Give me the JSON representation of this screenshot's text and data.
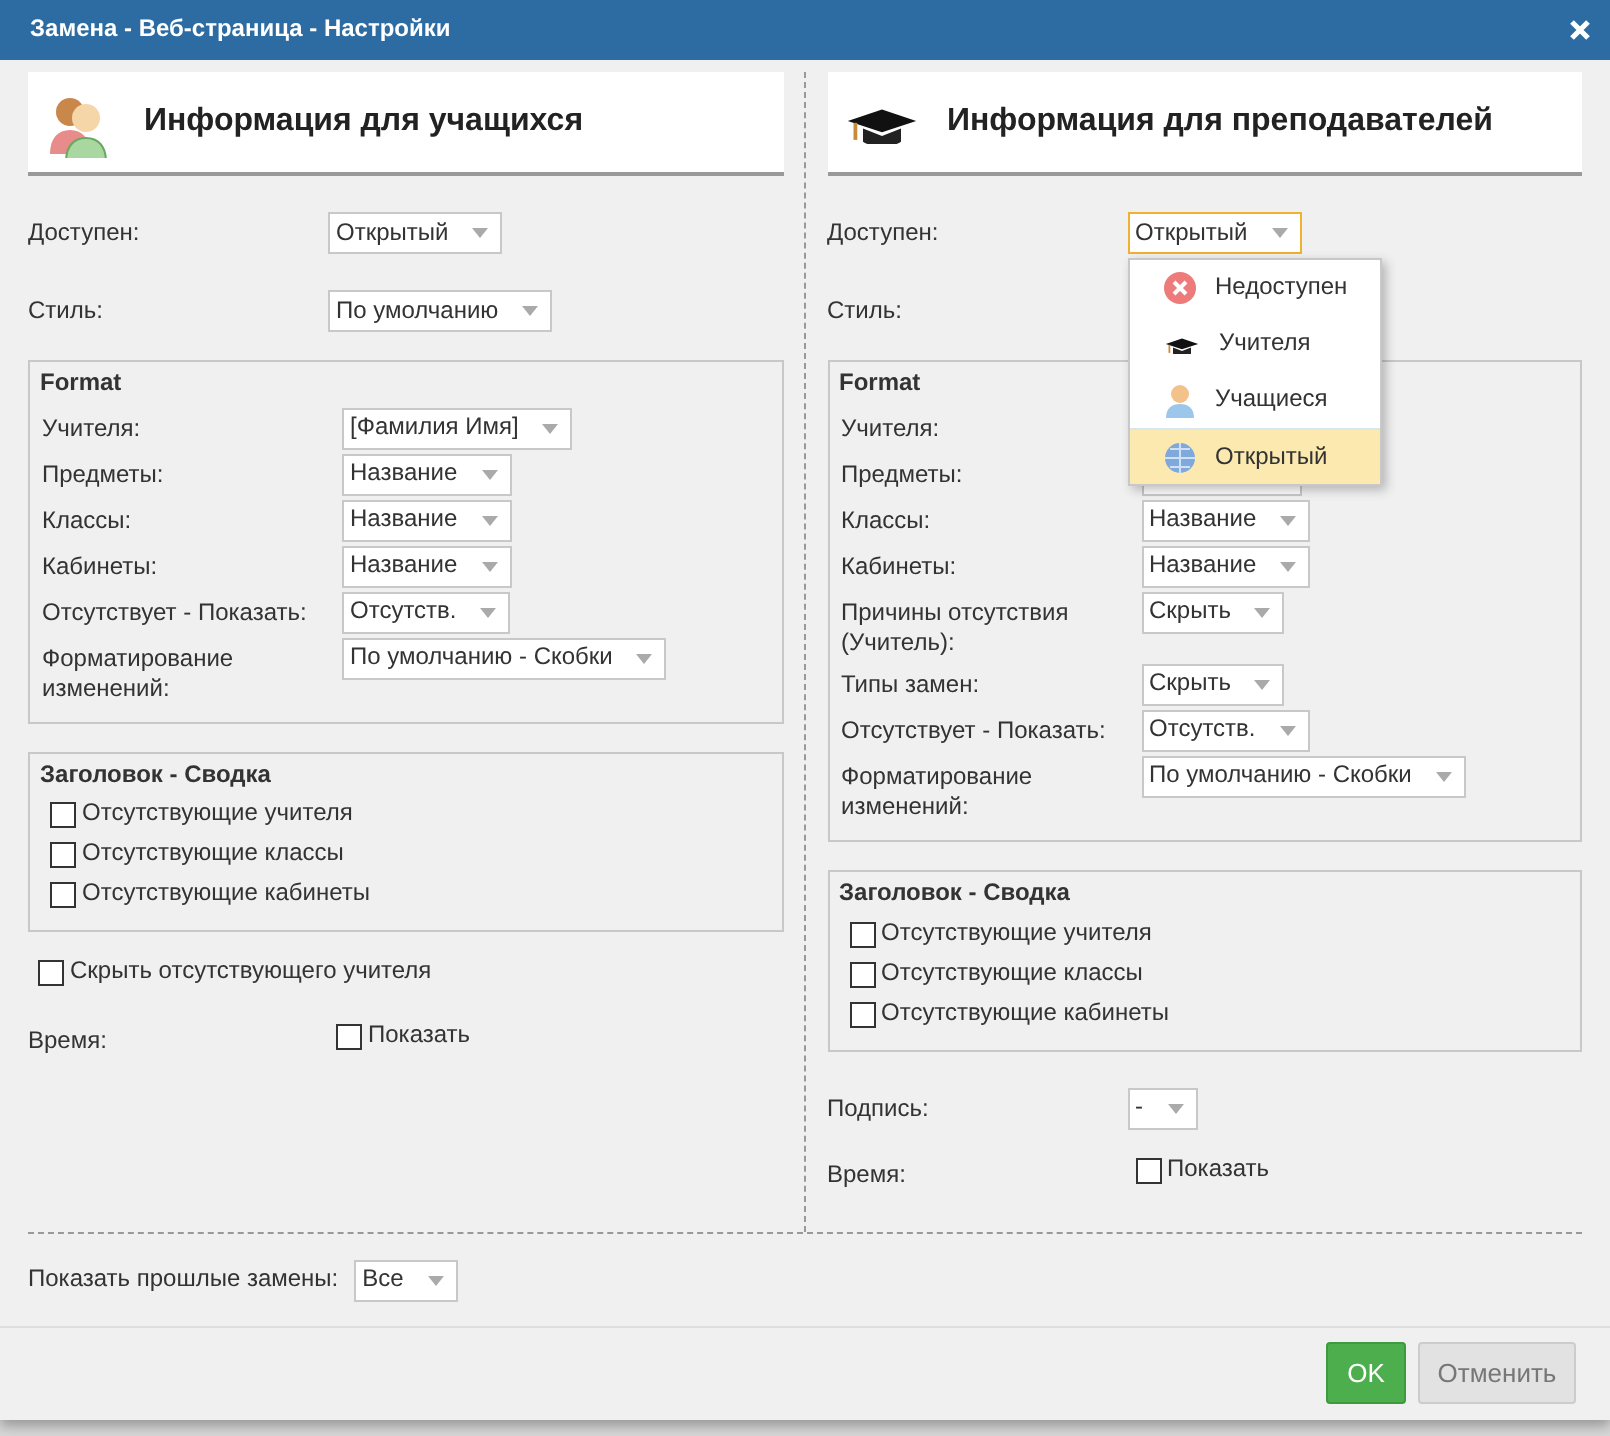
{
  "window": {
    "title": "Замена - Веб-страница - Настройки"
  },
  "panels": [
    {
      "kind": "students",
      "heading": "Информация для учащихся",
      "rows": [
        {
          "kind": "select",
          "label": "Доступен:",
          "value": "Открытый",
          "open": false
        },
        {
          "kind": "select",
          "label": "Стиль:",
          "value": "По умолчанию",
          "open": false
        },
        {
          "kind": "group",
          "title": "Format",
          "rows": [
            {
              "kind": "select",
              "label": "Учителя:",
              "value": "[Фамилия Имя]"
            },
            {
              "kind": "select",
              "label": "Предметы:",
              "value": "Название"
            },
            {
              "kind": "select",
              "label": "Классы:",
              "value": "Название"
            },
            {
              "kind": "select",
              "label": "Кабинеты:",
              "value": "Название"
            },
            {
              "kind": "select",
              "label": "Отсутствует - Показать:",
              "value": "Отсутств."
            },
            {
              "kind": "select",
              "label": "Форматирование изменений:",
              "value": "По умолчанию - Скобки"
            }
          ]
        },
        {
          "kind": "group",
          "title": "Заголовок - Сводка",
          "rows": [
            {
              "kind": "checkbox",
              "text": "Отсутствующие учителя",
              "checked": false
            },
            {
              "kind": "checkbox",
              "text": "Отсутствующие классы",
              "checked": false
            },
            {
              "kind": "checkbox",
              "text": "Отсутствующие кабинеты",
              "checked": false
            }
          ]
        },
        {
          "kind": "checkbox",
          "text": "Скрыть отсутствующего учителя",
          "checked": false
        },
        {
          "kind": "labeled_checkbox",
          "label": "Время:",
          "text": "Показать",
          "checked": false
        }
      ]
    },
    {
      "kind": "teachers",
      "heading": "Информация для преподавателей",
      "rows": [
        {
          "kind": "select",
          "label": "Доступен:",
          "value": "Открытый",
          "open": true,
          "options": [
            {
              "kind": "unavailable",
              "label": "Недоступен",
              "selected": false
            },
            {
              "kind": "teachers",
              "label": "Учителя",
              "selected": false
            },
            {
              "kind": "students",
              "label": "Учащиеся",
              "selected": false
            },
            {
              "kind": "open",
              "label": "Открытый",
              "selected": true
            }
          ]
        },
        {
          "kind": "label",
          "label": "Стиль:"
        },
        {
          "kind": "group",
          "title": "Format",
          "rows": [
            {
              "kind": "label",
              "label": "Учителя:"
            },
            {
              "kind": "select",
              "label": "Предметы:"
            },
            {
              "kind": "select",
              "label": "Классы:",
              "value": "Название"
            },
            {
              "kind": "select",
              "label": "Кабинеты:",
              "value": "Название"
            },
            {
              "kind": "select",
              "label": "Причины отсутствия (Учитель):",
              "value": "Скрыть"
            },
            {
              "kind": "select",
              "label": "Типы замен:",
              "value": "Скрыть"
            },
            {
              "kind": "select",
              "label": "Отсутствует - Показать:",
              "value": "Отсутств."
            },
            {
              "kind": "select",
              "label": "Форматирование изменений:",
              "value": "По умолчанию - Скобки"
            }
          ]
        },
        {
          "kind": "group",
          "title": "Заголовок - Сводка",
          "rows": [
            {
              "kind": "checkbox",
              "text": "Отсутствующие учителя",
              "checked": false
            },
            {
              "kind": "checkbox",
              "text": "Отсутствующие классы",
              "checked": false
            },
            {
              "kind": "checkbox",
              "text": "Отсутствующие кабинеты",
              "checked": false
            }
          ]
        },
        {
          "kind": "select",
          "label": "Подпись:",
          "value": "-",
          "open": false
        },
        {
          "kind": "labeled_checkbox",
          "label": "Время:",
          "text": "Показать",
          "checked": false
        }
      ]
    }
  ],
  "footer": {
    "label": "Показать прошлые замены:",
    "value": "Все"
  },
  "buttons": [
    {
      "kind": "primary",
      "label": "OK"
    },
    {
      "kind": "secondary",
      "label": "Отменить"
    }
  ]
}
